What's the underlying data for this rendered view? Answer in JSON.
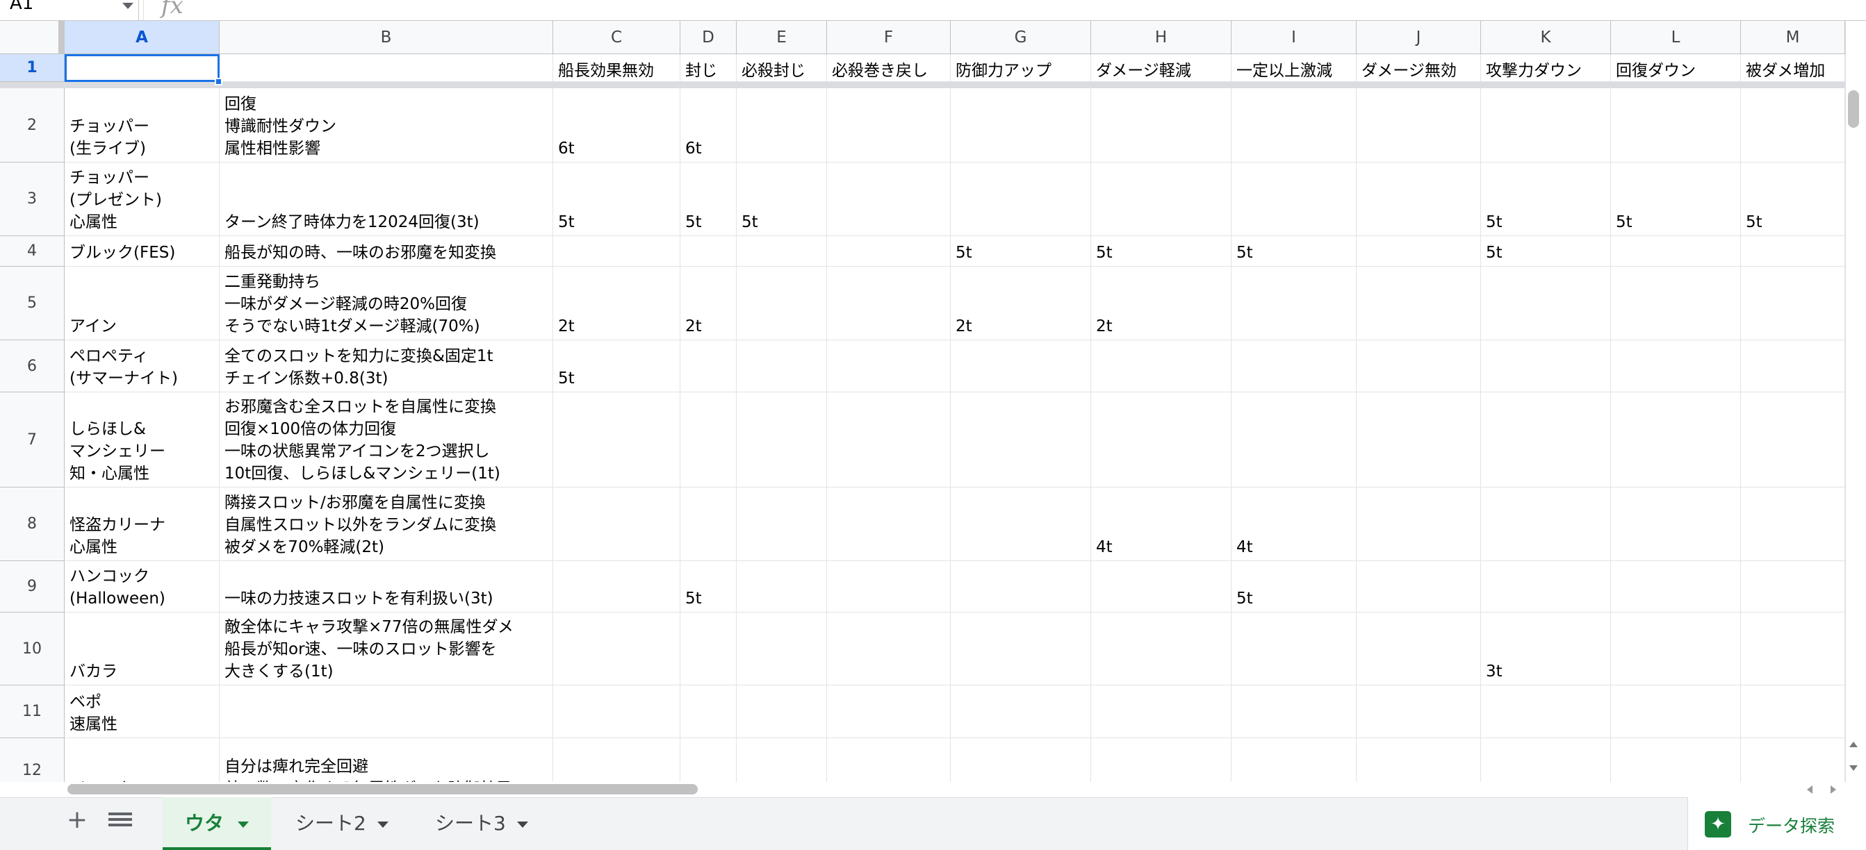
{
  "namebox": {
    "cell_ref": "A1"
  },
  "formula_bar": {
    "fx_label": "fx",
    "content": ""
  },
  "columns": [
    "A",
    "B",
    "C",
    "D",
    "E",
    "F",
    "G",
    "H",
    "I",
    "J",
    "K",
    "L",
    "M"
  ],
  "rows": [
    {
      "num": "1",
      "cells": [
        "",
        "",
        "船長効果無効",
        "封じ",
        "必殺封じ",
        "必殺巻き戻し",
        "防御力アップ",
        "ダメージ軽減",
        "一定以上激減",
        "ダメージ無効",
        "攻撃力ダウン",
        "回復ダウン",
        "被ダメ増加"
      ]
    },
    {
      "num": "2",
      "cells": [
        "チョッパー\n(生ライブ)",
        "回復\n博識耐性ダウン\n属性相性影響",
        "6t",
        "6t",
        "",
        "",
        "",
        "",
        "",
        "",
        "",
        "",
        ""
      ]
    },
    {
      "num": "3",
      "cells": [
        "チョッパー\n(プレゼント)\n心属性",
        "ターン終了時体力を12024回復(3t)",
        "5t",
        "5t",
        "5t",
        "",
        "",
        "",
        "",
        "",
        "5t",
        "5t",
        "5t"
      ]
    },
    {
      "num": "4",
      "cells": [
        "ブルック(FES)",
        "船長が知の時、一味のお邪魔を知変換",
        "",
        "",
        "",
        "",
        "5t",
        "5t",
        "5t",
        "",
        "5t",
        "",
        ""
      ]
    },
    {
      "num": "5",
      "cells": [
        "アイン",
        "二重発動持ち\n一味がダメージ軽減の時20%回復\nそうでない時1tダメージ軽減(70%)",
        "2t",
        "2t",
        "",
        "",
        "2t",
        "2t",
        "",
        "",
        "",
        "",
        ""
      ]
    },
    {
      "num": "6",
      "cells": [
        "ペロペティ\n(サマーナイト)",
        "全てのスロットを知力に変換&固定1t\nチェイン係数+0.8(3t)",
        "5t",
        "",
        "",
        "",
        "",
        "",
        "",
        "",
        "",
        "",
        ""
      ]
    },
    {
      "num": "7",
      "cells": [
        "しらほし&\nマンシェリー\n知・心属性",
        "お邪魔含む全スロットを自属性に変換\n回復×100倍の体力回復\n一味の状態異常アイコンを2つ選択し\n10t回復、しらほし&マンシェリー(1t)",
        "",
        "",
        "",
        "",
        "",
        "",
        "",
        "",
        "",
        "",
        ""
      ]
    },
    {
      "num": "8",
      "cells": [
        "怪盗カリーナ\n心属性",
        "隣接スロット/お邪魔を自属性に変換\n自属性スロット以外をランダムに変換\n被ダメを70%軽減(2t)",
        "",
        "",
        "",
        "",
        "",
        "4t",
        "4t",
        "",
        "",
        "",
        ""
      ]
    },
    {
      "num": "9",
      "cells": [
        "ハンコック\n(Halloween)",
        "一味の力技速スロットを有利扱い(3t)",
        "",
        "5t",
        "",
        "",
        "",
        "",
        "5t",
        "",
        "",
        "",
        ""
      ]
    },
    {
      "num": "10",
      "cells": [
        "バカラ",
        "敵全体にキャラ攻撃×77倍の無属性ダメ\n船長が知or速、一味のスロット影響を\n大きくする(1t)",
        "",
        "",
        "",
        "",
        "",
        "",
        "",
        "",
        "3t",
        "",
        ""
      ]
    },
    {
      "num": "11",
      "cells": [
        "ベポ\n速属性",
        "",
        "",
        "",
        "",
        "",
        "",
        "",
        "",
        "",
        "",
        "",
        ""
      ]
    },
    {
      "num": "12",
      "cells": [
        "ジャック",
        "自分は痺れ完全回避\n敵の数で変化する無属性ダメを防御効果",
        "",
        "",
        "",
        "",
        "",
        "",
        "",
        "",
        "",
        "",
        ""
      ]
    }
  ],
  "sheet_tabs": [
    {
      "label": "ウタ",
      "active": true
    },
    {
      "label": "シート2",
      "active": false
    },
    {
      "label": "シート3",
      "active": false
    }
  ],
  "explore": {
    "label": "データ探索",
    "icon": "sparkle-icon"
  },
  "colors": {
    "accent": "#1a73e8",
    "tab_active": "#188038",
    "grid_line": "#e2e3e3"
  }
}
